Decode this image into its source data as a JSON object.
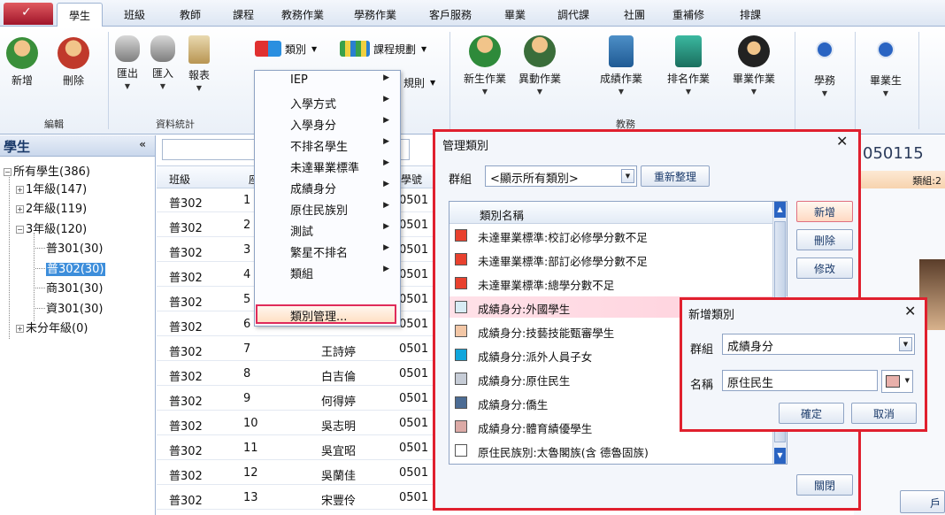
{
  "tabs": [
    {
      "label": "學生",
      "active": true
    },
    {
      "label": "班級"
    },
    {
      "label": "教師"
    },
    {
      "label": "課程"
    },
    {
      "label": "教務作業"
    },
    {
      "label": "學務作業"
    },
    {
      "label": "客戶服務"
    },
    {
      "label": "畢業"
    },
    {
      "label": "調代課"
    },
    {
      "label": "社團"
    },
    {
      "label": "重補修"
    },
    {
      "label": "排課"
    }
  ],
  "ribbon": {
    "edit_group": {
      "label": "編輯",
      "add": "新增",
      "delete": "刪除"
    },
    "stats_group": {
      "label": "資料統計",
      "export": "匯出",
      "import": "匯入",
      "report": "報表"
    },
    "category_button": "類別",
    "schedule_button": "課程規劃",
    "rule_button": "規則",
    "academic_group": {
      "label": "教務",
      "new_student": "新生作業",
      "transfer": "異動作業",
      "grades": "成績作業",
      "ranking": "排名作業",
      "graduation": "畢業作業"
    },
    "student_affairs": "學務",
    "graduate": "畢業生"
  },
  "left_panel": {
    "title": "學生",
    "collapse": "«",
    "tree": [
      {
        "label": "所有學生(386)",
        "level": 0,
        "exp": "−"
      },
      {
        "label": "1年級(147)",
        "level": 1,
        "exp": "+"
      },
      {
        "label": "2年級(119)",
        "level": 1,
        "exp": "+"
      },
      {
        "label": "3年級(120)",
        "level": 1,
        "exp": "−"
      },
      {
        "label": "普301(30)",
        "level": 2
      },
      {
        "label": "普302(30)",
        "level": 2,
        "selected": true
      },
      {
        "label": "商301(30)",
        "level": 2
      },
      {
        "label": "資301(30)",
        "level": 2
      },
      {
        "label": "未分年級(0)",
        "level": 1,
        "exp": "+"
      }
    ]
  },
  "grid": {
    "headers": {
      "class": "班級",
      "seat": "座",
      "student_no": "學號"
    },
    "rows": [
      {
        "class": "普302",
        "seat": "1",
        "name": "",
        "no": "0501"
      },
      {
        "class": "普302",
        "seat": "2",
        "name": "",
        "no": "0501"
      },
      {
        "class": "普302",
        "seat": "3",
        "name": "",
        "no": "0501"
      },
      {
        "class": "普302",
        "seat": "4",
        "name": "",
        "no": "0501"
      },
      {
        "class": "普302",
        "seat": "5",
        "name": "",
        "no": "0501"
      },
      {
        "class": "普302",
        "seat": "6",
        "name": "",
        "no": "0501"
      },
      {
        "class": "普302",
        "seat": "7",
        "name": "王詩婷",
        "no": "0501"
      },
      {
        "class": "普302",
        "seat": "8",
        "name": "白吉倫",
        "no": "0501"
      },
      {
        "class": "普302",
        "seat": "9",
        "name": "何得婷",
        "no": "0501"
      },
      {
        "class": "普302",
        "seat": "10",
        "name": "吳志明",
        "no": "0501"
      },
      {
        "class": "普302",
        "seat": "11",
        "name": "吳宜昭",
        "no": "0501"
      },
      {
        "class": "普302",
        "seat": "12",
        "name": "吳蘭佳",
        "no": "0501"
      },
      {
        "class": "普302",
        "seat": "13",
        "name": "宋豐伶",
        "no": "0501"
      }
    ]
  },
  "category_menu": {
    "items": [
      {
        "label": "IEP",
        "sub": true
      },
      {
        "label": "入學方式",
        "sub": true
      },
      {
        "label": "入學身分",
        "sub": true
      },
      {
        "label": "不排名學生",
        "sub": true
      },
      {
        "label": "未達畢業標準",
        "sub": true
      },
      {
        "label": "成績身分",
        "sub": true
      },
      {
        "label": "原住民族別",
        "sub": true
      },
      {
        "label": "測試",
        "sub": true
      },
      {
        "label": "繁星不排名",
        "sub": true
      },
      {
        "label": "類組",
        "sub": true
      },
      {
        "label": "類別管理...",
        "sub": false,
        "highlighted": true
      }
    ]
  },
  "right_pane": {
    "student_no": "050115",
    "group_tag": "類組:2",
    "btn_partial": "戶"
  },
  "manage_dialog": {
    "title": "管理類別",
    "group_label": "群組",
    "group_value": "<顯示所有類別>",
    "refresh_button": "重新整理",
    "column_header": "類別名稱",
    "add_button": "新增",
    "delete_button": "刪除",
    "edit_button": "修改",
    "close_button": "關閉",
    "rows": [
      {
        "label": "未達畢業標準:校訂必修學分數不足",
        "color": "#e8412e"
      },
      {
        "label": "未達畢業標準:部訂必修學分數不足",
        "color": "#e8412e"
      },
      {
        "label": "未達畢業標準:總學分數不足",
        "color": "#e8412e"
      },
      {
        "label": "成績身分:外國學生",
        "color": "#d8ecf4",
        "selected": true
      },
      {
        "label": "成績身分:技藝技能甄審學生",
        "color": "#f3c7a6"
      },
      {
        "label": "成績身分:派外人員子女",
        "color": "#10a6dc"
      },
      {
        "label": "成績身分:原住民生",
        "color": "#c6ccd6"
      },
      {
        "label": "成績身分:僑生",
        "color": "#4c6c94"
      },
      {
        "label": "成績身分:體育績優學生",
        "color": "#dcaaa6"
      },
      {
        "label": "原住民族別:太魯閣族(含 德魯固族)",
        "color": "#ffffff"
      }
    ]
  },
  "add_dialog": {
    "title": "新增類別",
    "group_label": "群組",
    "group_value": "成績身分",
    "name_label": "名稱",
    "name_value": "原住民生",
    "swatch_color": "#e8b0aa",
    "ok_button": "確定",
    "cancel_button": "取消"
  },
  "colors": {
    "accent_red": "#e0202e",
    "selection_blue": "#3d8edb"
  }
}
